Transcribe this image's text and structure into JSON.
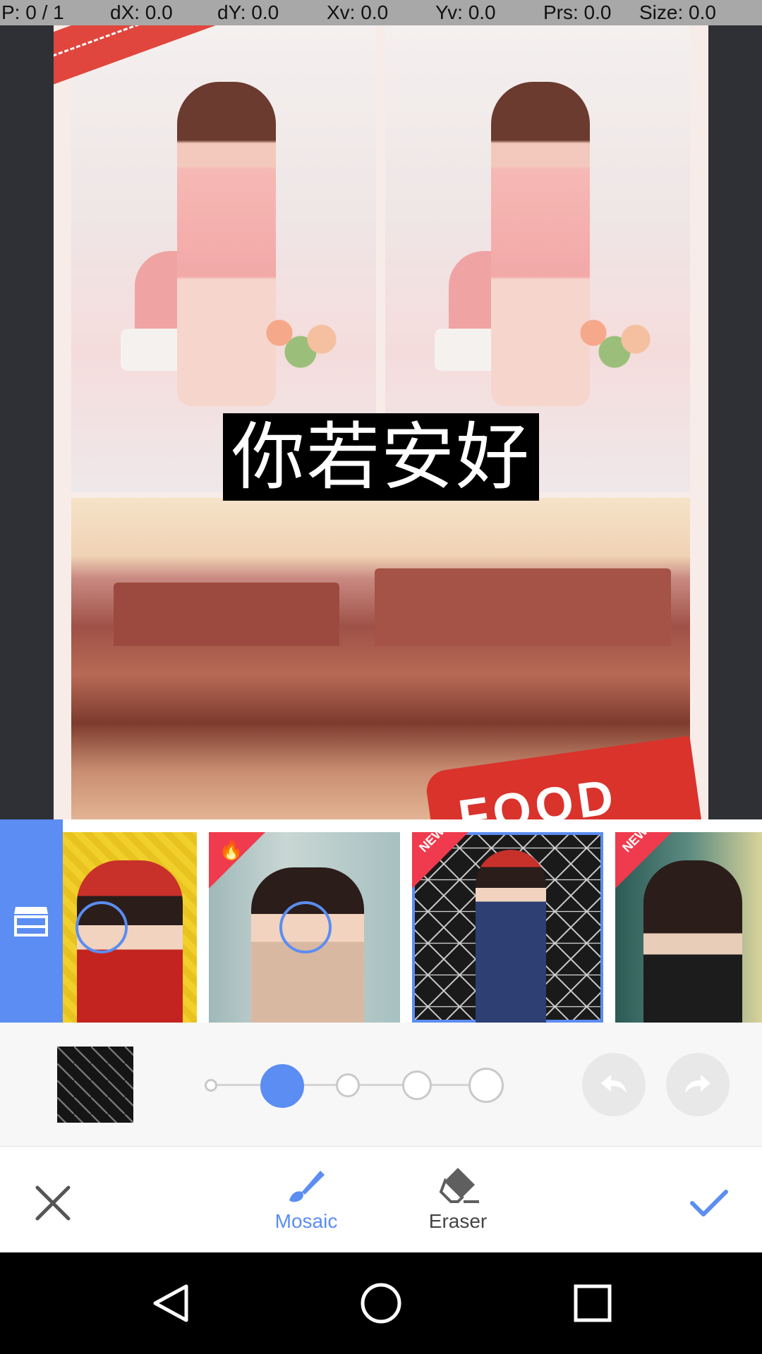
{
  "debug": {
    "pointer": "P: 0 / 1",
    "dx": "dX: 0.0",
    "dy": "dY: 0.0",
    "xv": "Xv: 0.0",
    "yv": "Yv: 0.0",
    "prs": "Prs: 0.0",
    "size": "Size: 0.0"
  },
  "canvas": {
    "text_sticker": "你若安好",
    "food_banner": "FOOD"
  },
  "patterns": {
    "items": [
      {
        "badge": "",
        "icon": "none",
        "selected": false
      },
      {
        "badge": "",
        "icon": "fire-icon",
        "selected": false
      },
      {
        "badge": "NEW",
        "icon": "none",
        "selected": true
      },
      {
        "badge": "NEW",
        "icon": "none",
        "selected": false
      }
    ]
  },
  "brush": {
    "sizes": 5,
    "selected_size_index": 1
  },
  "tools": {
    "mosaic_label": "Mosaic",
    "eraser_label": "Eraser",
    "active_tool": "Mosaic"
  },
  "colors": {
    "accent": "#5b8df2",
    "badge_red": "#ef3b4d",
    "sticker_bg": "#000000"
  }
}
